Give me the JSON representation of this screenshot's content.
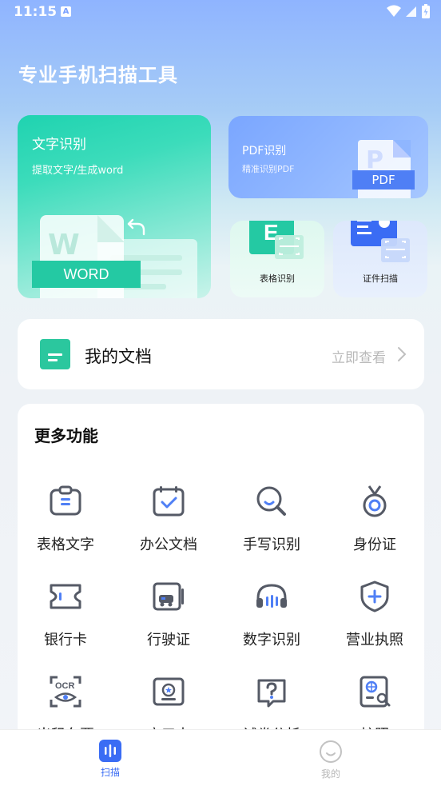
{
  "status_bar": {
    "time": "11:15",
    "badge": "A"
  },
  "headline": "专业手机扫描工具",
  "cards": {
    "ocr": {
      "title": "文字识别",
      "subtitle": "提取文字/生成word",
      "badge": "WORD",
      "watermark": "W"
    },
    "pdf": {
      "title": "PDF识别",
      "subtitle": "精准识别PDF",
      "badge": "PDF",
      "watermark": "P"
    },
    "table": {
      "label": "表格识别",
      "glyph": "E"
    },
    "id_scan": {
      "label": "证件扫描"
    }
  },
  "my_docs": {
    "title": "我的文档",
    "action": "立即查看"
  },
  "more_features": {
    "heading": "更多功能",
    "items": [
      {
        "label": "表格文字",
        "icon": "clipboard-icon"
      },
      {
        "label": "办公文档",
        "icon": "calendar-check-icon"
      },
      {
        "label": "手写识别",
        "icon": "magnifier-icon"
      },
      {
        "label": "身份证",
        "icon": "medal-icon"
      },
      {
        "label": "银行卡",
        "icon": "bank-card-icon"
      },
      {
        "label": "行驶证",
        "icon": "vehicle-license-icon"
      },
      {
        "label": "数字识别",
        "icon": "headphones-icon"
      },
      {
        "label": "营业执照",
        "icon": "shield-plus-icon"
      },
      {
        "label": "出租车票",
        "icon": "ocr-eye-icon"
      },
      {
        "label": "户口本",
        "icon": "certificate-icon"
      },
      {
        "label": "试卷分析",
        "icon": "question-icon"
      },
      {
        "label": "护照",
        "icon": "passport-icon"
      }
    ],
    "ocr_tag": "OCR"
  },
  "tabs": [
    {
      "label": "扫描",
      "active": true
    },
    {
      "label": "我的",
      "active": false
    }
  ],
  "colors": {
    "accent": "#3a6cf4",
    "green": "#24c9a3",
    "icon_gray": "#555a66",
    "icon_blue": "#4f7ff5"
  }
}
